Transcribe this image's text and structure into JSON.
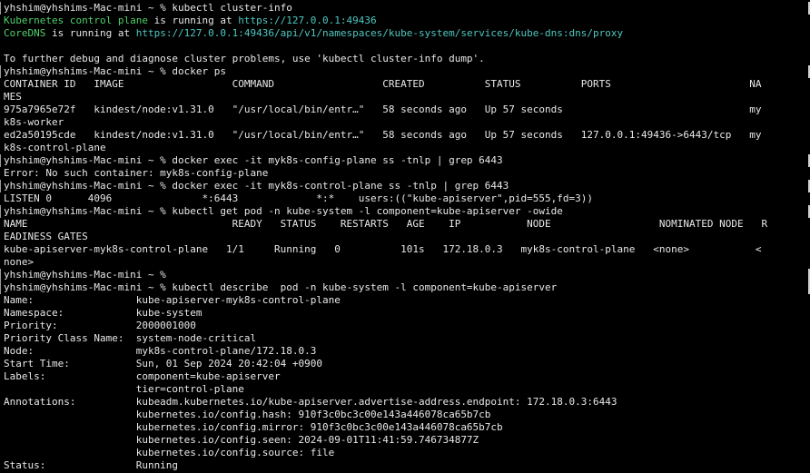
{
  "theme": {
    "background": "#000000",
    "foreground": "#e8e8e8",
    "green": "#4fd06a",
    "teal": "#4fc7c0"
  },
  "lines": [
    {
      "prompt": true,
      "segs": [
        {
          "t": "yhshim@yhshims-Mac-mini ~ % kubectl cluster-info"
        }
      ]
    },
    {
      "segs": [
        {
          "t": "Kubernetes control plane",
          "c": "green"
        },
        {
          "t": " is running at "
        },
        {
          "t": "https://127.0.0.1:49436",
          "c": "teal"
        }
      ]
    },
    {
      "segs": [
        {
          "t": "CoreDNS",
          "c": "green"
        },
        {
          "t": " is running at "
        },
        {
          "t": "https://127.0.0.1:49436/api/v1/namespaces/kube-system/services/kube-dns:dns/proxy",
          "c": "teal"
        }
      ]
    },
    {
      "segs": [
        {
          "t": ""
        }
      ]
    },
    {
      "segs": [
        {
          "t": "To further debug and diagnose cluster problems, use 'kubectl cluster-info dump'."
        }
      ]
    },
    {
      "prompt": true,
      "segs": [
        {
          "t": "yhshim@yhshims-Mac-mini ~ % docker ps"
        }
      ]
    },
    {
      "segs": [
        {
          "t": "CONTAINER ID   IMAGE                  COMMAND                  CREATED          STATUS          PORTS                       NA"
        }
      ]
    },
    {
      "segs": [
        {
          "t": "MES"
        }
      ]
    },
    {
      "segs": [
        {
          "t": "975a7965e72f   kindest/node:v1.31.0   \"/usr/local/bin/entr…\"   58 seconds ago   Up 57 seconds                               my"
        }
      ]
    },
    {
      "segs": [
        {
          "t": "k8s-worker"
        }
      ]
    },
    {
      "segs": [
        {
          "t": "ed2a50195cde   kindest/node:v1.31.0   \"/usr/local/bin/entr…\"   58 seconds ago   Up 57 seconds   127.0.0.1:49436->6443/tcp   my"
        }
      ]
    },
    {
      "segs": [
        {
          "t": "k8s-control-plane"
        }
      ]
    },
    {
      "prompt": true,
      "segs": [
        {
          "t": "yhshim@yhshims-Mac-mini ~ % docker exec -it myk8s-config-plane ss -tnlp | grep 6443"
        }
      ]
    },
    {
      "segs": [
        {
          "t": "Error: No such container: myk8s-config-plane"
        }
      ]
    },
    {
      "prompt": true,
      "segs": [
        {
          "t": "yhshim@yhshims-Mac-mini ~ % docker exec -it myk8s-control-plane ss -tnlp | grep 6443"
        }
      ]
    },
    {
      "segs": [
        {
          "t": "LISTEN 0      4096               *:6443             *:*    users:((\"kube-apiserver\",pid=555,fd=3))"
        }
      ]
    },
    {
      "prompt": true,
      "segs": [
        {
          "t": "yhshim@yhshims-Mac-mini ~ % kubectl get pod -n kube-system -l component=kube-apiserver -owide"
        }
      ]
    },
    {
      "segs": [
        {
          "t": "NAME                                  READY   STATUS    RESTARTS   AGE    IP           NODE                  NOMINATED NODE   R"
        }
      ]
    },
    {
      "segs": [
        {
          "t": "EADINESS GATES"
        }
      ]
    },
    {
      "segs": [
        {
          "t": "kube-apiserver-myk8s-control-plane   1/1     Running   0          101s   172.18.0.3   myk8s-control-plane   <none>           <"
        }
      ]
    },
    {
      "segs": [
        {
          "t": "none>"
        }
      ]
    },
    {
      "prompt": true,
      "segs": [
        {
          "t": "yhshim@yhshims-Mac-mini ~ %"
        }
      ]
    },
    {
      "prompt": true,
      "segs": [
        {
          "t": "yhshim@yhshims-Mac-mini ~ % kubectl describe  pod -n kube-system -l component=kube-apiserver"
        }
      ]
    },
    {
      "segs": [
        {
          "t": "Name:                 kube-apiserver-myk8s-control-plane"
        }
      ]
    },
    {
      "segs": [
        {
          "t": "Namespace:            kube-system"
        }
      ]
    },
    {
      "segs": [
        {
          "t": "Priority:             2000001000"
        }
      ]
    },
    {
      "segs": [
        {
          "t": "Priority Class Name:  system-node-critical"
        }
      ]
    },
    {
      "segs": [
        {
          "t": "Node:                 myk8s-control-plane/172.18.0.3"
        }
      ]
    },
    {
      "segs": [
        {
          "t": "Start Time:           Sun, 01 Sep 2024 20:42:04 +0900"
        }
      ]
    },
    {
      "segs": [
        {
          "t": "Labels:               component=kube-apiserver"
        }
      ]
    },
    {
      "segs": [
        {
          "t": "                      tier=control-plane"
        }
      ]
    },
    {
      "segs": [
        {
          "t": "Annotations:          kubeadm.kubernetes.io/kube-apiserver.advertise-address.endpoint: 172.18.0.3:6443"
        }
      ]
    },
    {
      "segs": [
        {
          "t": "                      kubernetes.io/config.hash: 910f3c0bc3c00e143a446078ca65b7cb"
        }
      ]
    },
    {
      "segs": [
        {
          "t": "                      kubernetes.io/config.mirror: 910f3c0bc3c00e143a446078ca65b7cb"
        }
      ]
    },
    {
      "segs": [
        {
          "t": "                      kubernetes.io/config.seen: 2024-09-01T11:41:59.746734877Z"
        }
      ]
    },
    {
      "segs": [
        {
          "t": "                      kubernetes.io/config.source: file"
        }
      ]
    },
    {
      "segs": [
        {
          "t": "Status:               Running"
        }
      ]
    }
  ]
}
